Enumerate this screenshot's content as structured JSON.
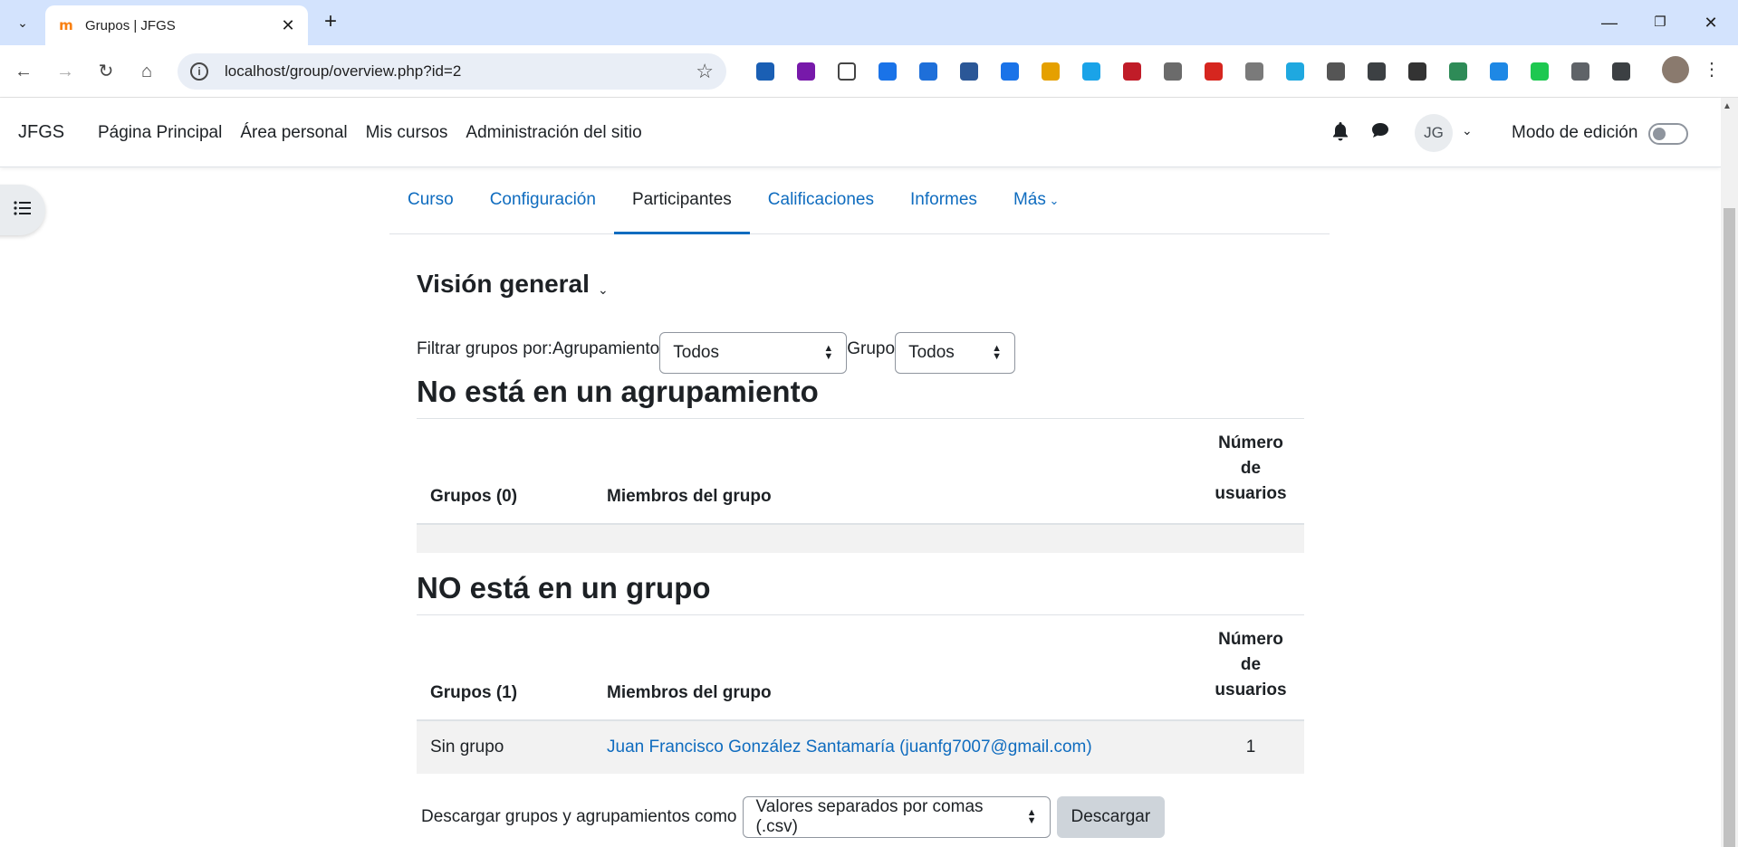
{
  "browser": {
    "tab_title": "Grupos | JFGS",
    "tab_close": "✕",
    "new_tab": "+",
    "url": "localhost/group/overview.php?id=2",
    "win_minimize": "—",
    "win_restore": "❐",
    "win_close": "✕"
  },
  "extensions": [
    {
      "name": "1password",
      "color": "#1a5fb4"
    },
    {
      "name": "onenote",
      "color": "#7719aa"
    },
    {
      "name": "cloud",
      "color": "#ffffff"
    },
    {
      "name": "ext-blue-circle",
      "color": "#1a73e8"
    },
    {
      "name": "download-manager",
      "color": "#1e6fd9"
    },
    {
      "name": "save",
      "color": "#2b5797"
    },
    {
      "name": "doc-download",
      "color": "#1a73e8"
    },
    {
      "name": "ext-yellow",
      "color": "#e5a000"
    },
    {
      "name": "ext-s-blue",
      "color": "#1aa3e8"
    },
    {
      "name": "link",
      "color": "#c01c28"
    },
    {
      "name": "ext-gray",
      "color": "#6b6b6b"
    },
    {
      "name": "mendeley",
      "color": "#d6261f"
    },
    {
      "name": "notes",
      "color": "#7a7a7a"
    },
    {
      "name": "ext-s-square",
      "color": "#1fa8e0"
    },
    {
      "name": "doc-pdf",
      "color": "#555555"
    },
    {
      "name": "download-arrow",
      "color": "#3c4043"
    },
    {
      "name": "ext-pen",
      "color": "#333333"
    },
    {
      "name": "puzzle-green",
      "color": "#2e8b57"
    },
    {
      "name": "sitemap",
      "color": "#1e88e5"
    },
    {
      "name": "ext-sp",
      "color": "#1ec850"
    },
    {
      "name": "trash",
      "color": "#5f6368"
    },
    {
      "name": "extensions-puzzle",
      "color": "#3c4043"
    }
  ],
  "site": {
    "brand": "JFGS",
    "nav": [
      "Página Principal",
      "Área personal",
      "Mis cursos",
      "Administración del sitio"
    ],
    "avatar_initials": "JG",
    "edit_mode_label": "Modo de edición"
  },
  "secondary_nav": {
    "items": [
      "Curso",
      "Configuración",
      "Participantes",
      "Calificaciones",
      "Informes",
      "Más"
    ],
    "active": "Participantes"
  },
  "main": {
    "title": "Visión general",
    "filter_label": "Filtrar grupos por:",
    "grouping_label": "Agrupamiento",
    "grouping_value": "Todos",
    "group_label": "Grupo",
    "group_value": "Todos",
    "section1": {
      "heading": "No está en un agrupamiento",
      "col_groups": "Grupos (0)",
      "col_members": "Miembros del grupo",
      "col_count": [
        "Número",
        "de",
        "usuarios"
      ]
    },
    "section2": {
      "heading": "NO está en un grupo",
      "col_groups": "Grupos (1)",
      "col_members": "Miembros del grupo",
      "col_count": [
        "Número",
        "de",
        "usuarios"
      ],
      "rows": [
        {
          "group": "Sin grupo",
          "member": "Juan Francisco González Santamaría (juanfg7007@gmail.com)",
          "count": "1"
        }
      ]
    },
    "download_label": "Descargar grupos y agrupamientos como",
    "download_format": "Valores separados por comas (.csv)",
    "download_button": "Descargar"
  },
  "colors": {
    "link": "#0f6cbf",
    "tabbar": "#d3e3fd",
    "button_secondary": "#ced4da"
  }
}
